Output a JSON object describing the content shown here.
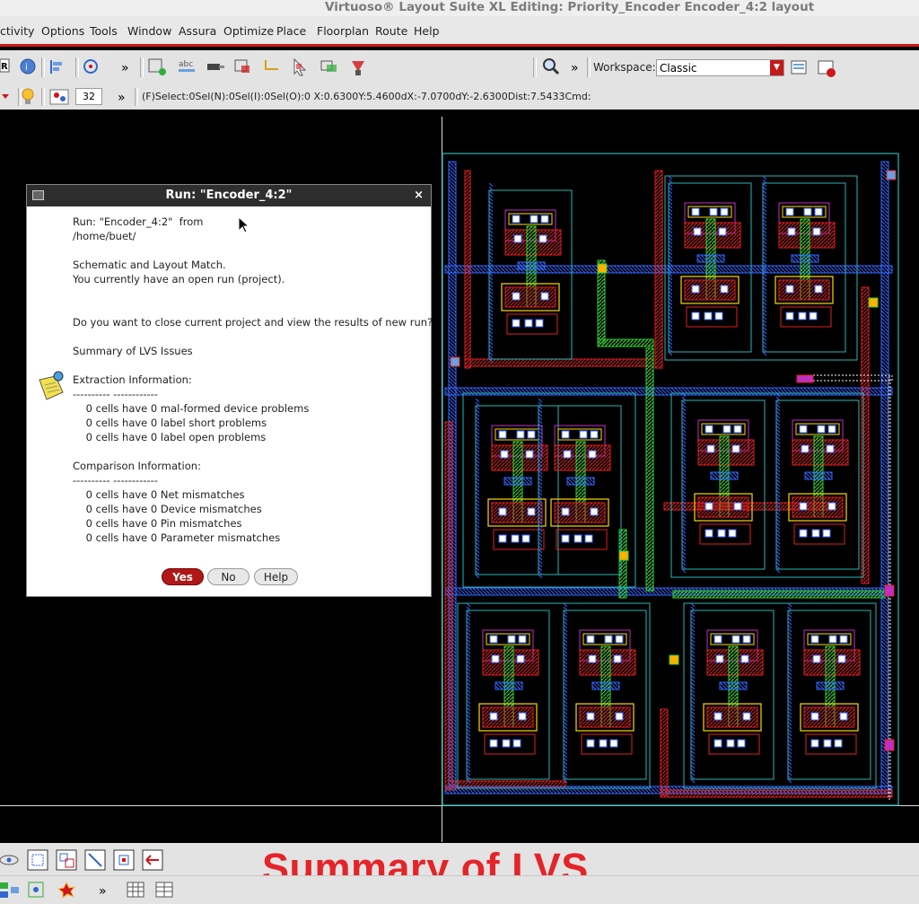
{
  "window": {
    "title": "Virtuoso® Layout Suite XL Editing: Priority_Encoder Encoder_4:2 layout"
  },
  "menu": [
    "ctivity",
    "Options",
    "Tools",
    "Window",
    "Assura",
    "Optimize",
    "Place",
    "Floorplan",
    "Route",
    "Help"
  ],
  "toolbar": {
    "more_glyph": "»",
    "workspace_label": "Workspace:",
    "workspace_value": "Classic"
  },
  "toolbar2": {
    "spin_value": "32",
    "status_text": "(F)Select:0Sel(N):0Sel(I):0Sel(O):0 X:0.6300Y:5.4600dX:-7.0700dY:-2.6300Dist:7.5433Cmd:"
  },
  "dialog": {
    "title": "Run: \"Encoder_4:2\"",
    "close_glyph": "×",
    "lines": [
      "Run: \"Encoder_4:2\"  from",
      "/home/buet/",
      "",
      "Schematic and Layout Match.",
      "You currently have an open run (project).",
      "",
      "",
      "Do you want to close current project and view the results of new run?",
      "",
      "Summary of LVS Issues",
      "",
      "Extraction Information:",
      "---------- ------------",
      "    0 cells have 0 mal-formed device problems",
      "    0 cells have 0 label short problems",
      "    0 cells have 0 label open problems",
      "",
      "Comparison Information:",
      "---------- ------------",
      "    0 cells have 0 Net mismatches",
      "    0 cells have 0 Device mismatches",
      "    0 cells have 0 Pin mismatches",
      "    0 cells have 0 Parameter mismatches"
    ],
    "buttons": {
      "yes": "Yes",
      "no": "No",
      "help": "Help"
    }
  },
  "overlay_caption": "Summary of LVS",
  "colors": {
    "accent_red": "#d0151a",
    "caption_red": "#e42429",
    "yes_button": "#b01818"
  }
}
